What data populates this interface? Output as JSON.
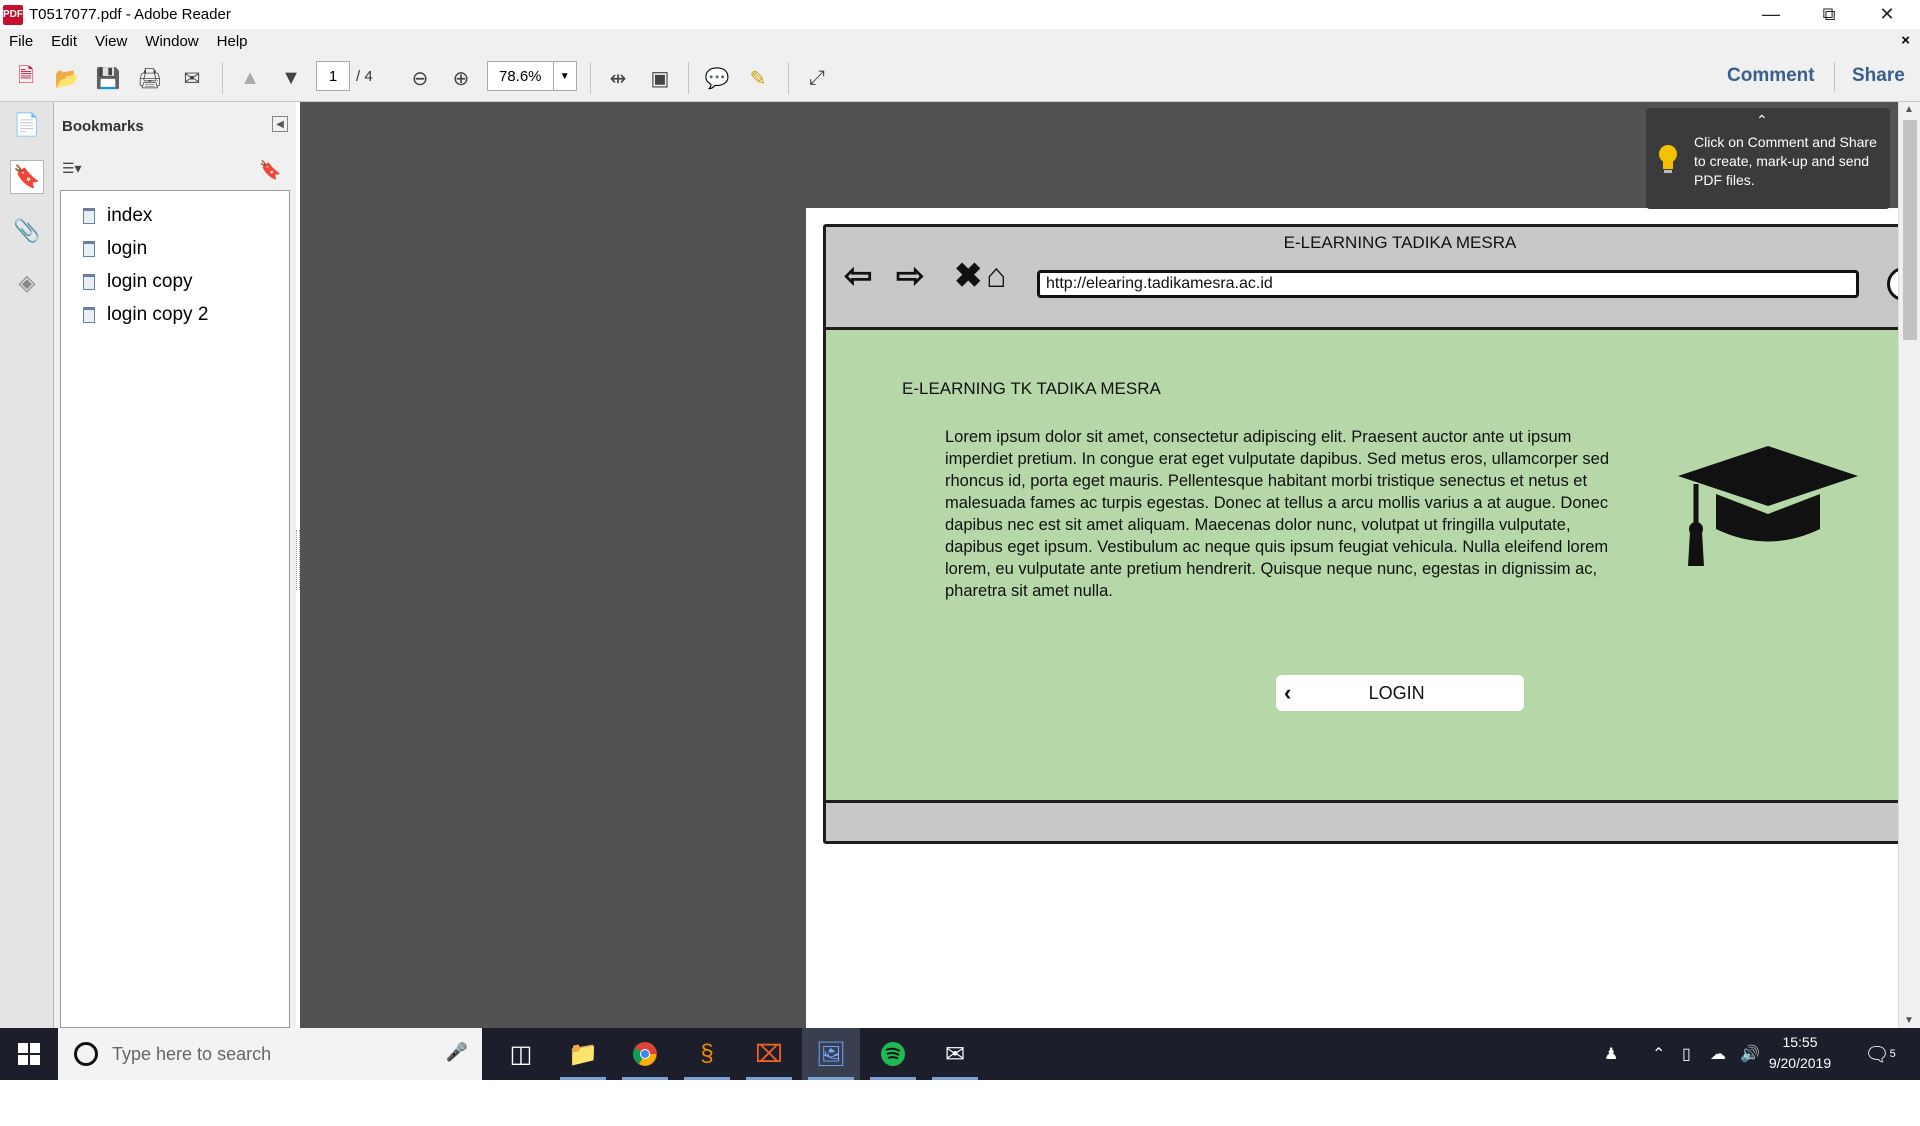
{
  "window": {
    "title": "T0517077.pdf - Adobe Reader",
    "app_icon": "pdf"
  },
  "menu": {
    "items": [
      "File",
      "Edit",
      "View",
      "Window",
      "Help"
    ],
    "close": "×"
  },
  "toolbar": {
    "page_current": "1",
    "page_total": "/ 4",
    "zoom": "78.6%",
    "comment": "Comment",
    "share": "Share"
  },
  "bookmarks": {
    "title": "Bookmarks",
    "items": [
      "index",
      "login",
      "login copy",
      "login copy 2"
    ]
  },
  "tooltip": {
    "text": "Click on Comment and Share to create, mark-up and send PDF files."
  },
  "mockup": {
    "title": "E-LEARNING TADIKA MESRA",
    "url": "http://elearing.tadikamesra.ac.id",
    "content_title": "E-LEARNING TK TADIKA MESRA",
    "body": "Lorem ipsum dolor sit amet, consectetur adipiscing elit. Praesent auctor ante ut ipsum imperdiet pretium. In congue erat eget vulputate dapibus. Sed metus eros, ullamcorper sed rhoncus id, porta eget mauris. Pellentesque habitant morbi tristique senectus et netus et malesuada fames ac turpis egestas. Donec at tellus a arcu mollis varius a at augue. Donec dapibus nec est sit amet aliquam. Maecenas dolor nunc, volutpat ut fringilla vulputate, dapibus eget ipsum. Vestibulum ac neque quis ipsum feugiat vehicula. Nulla eleifend lorem lorem, eu vulputate ante pretium hendrerit. Quisque neque nunc, egestas in dignissim ac, pharetra sit amet nulla.",
    "login_label": "LOGIN",
    "bg_color": "#b6d7a8"
  },
  "taskbar": {
    "search_placeholder": "Type here to search",
    "time": "15:55",
    "date": "9/20/2019",
    "notifications": "5"
  }
}
